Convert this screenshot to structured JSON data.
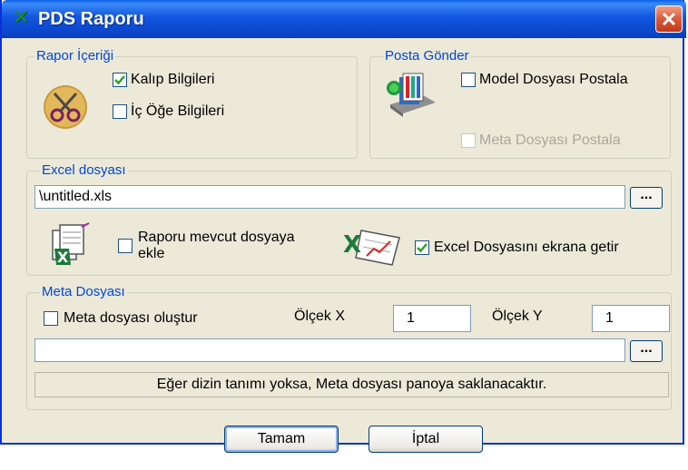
{
  "window": {
    "title": "PDS Raporu"
  },
  "report_content": {
    "title": "Rapor İçeriği",
    "mold_info": {
      "label": "Kalıp Bilgileri",
      "checked": true
    },
    "inner_item_info": {
      "label": "İç Öğe Bilgileri",
      "checked": false
    }
  },
  "send_mail": {
    "title": "Posta Gönder",
    "model_file": {
      "label": "Model Dosyası Postala",
      "checked": false
    },
    "meta_file": {
      "label": "Meta Dosyası Postala",
      "checked": false,
      "enabled": false
    }
  },
  "excel": {
    "title": "Excel dosyası",
    "path": "\\untitled.xls",
    "browse_label": "...",
    "append_label_line1": "Raporu mevcut dosyaya",
    "append_label_line2": "ekle",
    "append_checked": false,
    "show_label": "Excel Dosyasını ekrana getir",
    "show_checked": true
  },
  "meta": {
    "title": "Meta Dosyası",
    "create_label": "Meta dosyası oluştur",
    "create_checked": false,
    "scale_x_label": "Ölçek X",
    "scale_x_value": "1",
    "scale_y_label": "Ölçek Y",
    "scale_y_value": "1",
    "path": "",
    "browse_label": "...",
    "info": "Eğer dizin tanımı yoksa, Meta dosyası panoya saklanacaktır."
  },
  "buttons": {
    "ok": "Tamam",
    "cancel": "İptal"
  },
  "colors": {
    "title_bar": "#0a44c8",
    "dialog_bg": "#ece9d8",
    "group_title": "#0046d5"
  }
}
